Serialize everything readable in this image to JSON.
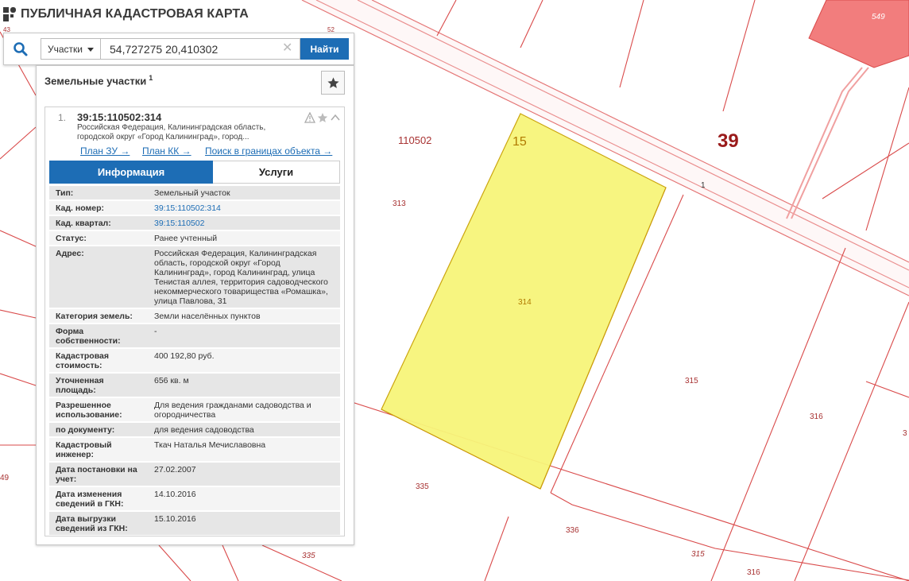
{
  "app": {
    "title": "ПУБЛИЧНАЯ КАДАСТРОВАЯ КАРТА"
  },
  "search": {
    "type_label": "Участки",
    "query": "54,727275 20,410302",
    "button_label": "Найти"
  },
  "panel": {
    "title": "Земельные участки",
    "count": "1"
  },
  "result": {
    "number": "1.",
    "cadastral_id": "39:15:110502:314",
    "address_short": "Российская Федерация, Калининградская область, городской округ «Город Калининград», город...",
    "links": {
      "plan_zu": "План ЗУ →",
      "plan_kk": "План КК →",
      "search_bounds": "Поиск в границах объекта →"
    }
  },
  "tabs": {
    "info": "Информация",
    "services": "Услуги"
  },
  "info_rows": [
    {
      "key": "Тип:",
      "value": "Земельный участок",
      "link": false
    },
    {
      "key": "Кад. номер:",
      "value": "39:15:110502:314",
      "link": true
    },
    {
      "key": "Кад. квартал:",
      "value": "39:15:110502",
      "link": true
    },
    {
      "key": "Статус:",
      "value": "Ранее учтенный",
      "link": false
    },
    {
      "key": "Адрес:",
      "value": "Российская Федерация, Калининградская область, городской округ «Город Калининград», город Калининград, улица Тенистая аллея, территория садоводческого некоммерческого товарищества «Ромашка», улица Павлова, 31",
      "link": false
    },
    {
      "key": "Категория земель:",
      "value": "Земли населённых пунктов",
      "link": false
    },
    {
      "key": "Форма собственности:",
      "value": "-",
      "link": false
    },
    {
      "key": "Кадастровая стоимость:",
      "value": "400 192,80 руб.",
      "link": false
    },
    {
      "key": "Уточненная площадь:",
      "value": "656 кв. м",
      "link": false
    },
    {
      "key": "Разрешенное использование:",
      "value": "Для ведения гражданами садоводства и огородничества",
      "link": false
    },
    {
      "key": "по документу:",
      "value": "для ведения садоводства",
      "link": false
    },
    {
      "key": "Кадастровый инженер:",
      "value": "Ткач Наталья Мечиславовна",
      "link": false
    },
    {
      "key": "Дата постановки на учет:",
      "value": "27.02.2007",
      "link": false
    },
    {
      "key": "Дата изменения сведений в ГКН:",
      "value": "14.10.2016",
      "link": false
    },
    {
      "key": "Дата выгрузки сведений из ГКН:",
      "value": "15.10.2016",
      "link": false
    }
  ],
  "map_labels": {
    "quarter": "110502",
    "plot_num_large": "15",
    "district": "39",
    "parcel_313": "313",
    "parcel_314": "314",
    "parcel_315": "315",
    "parcel_315b": "315",
    "parcel_316": "316",
    "parcel_316b": "316",
    "parcel_335": "335",
    "parcel_335b": "335",
    "parcel_336": "336",
    "parcel_549": "549",
    "road_1": "1",
    "edge_3": "3",
    "edge_49": "49",
    "edge_43": "43",
    "edge_52": "52"
  },
  "colors": {
    "accent": "#1d6db5",
    "parcel_line": "#d94a4a",
    "selected_fill": "#f7f57a",
    "neighbor_fill": "#f27d7d"
  }
}
